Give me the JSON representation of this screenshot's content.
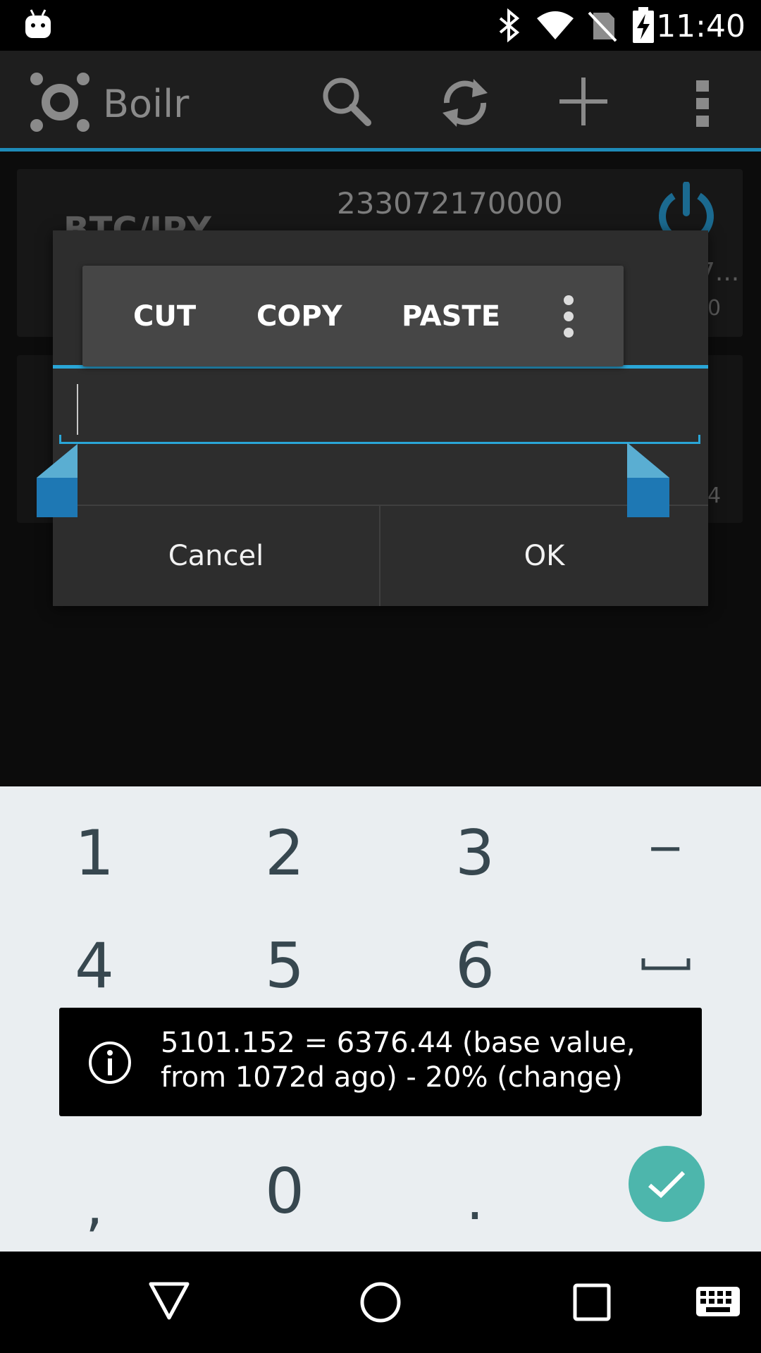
{
  "status_bar": {
    "time": "11:40"
  },
  "app": {
    "title": "Boilr"
  },
  "background": {
    "value": "233072170000",
    "pair": "BTC/JPY",
    "fragment_1": "7...",
    "fragment_2": "0",
    "fragment_3": "4"
  },
  "context_menu": {
    "cut": "CUT",
    "copy": "COPY",
    "paste": "PASTE"
  },
  "dialog": {
    "input_value": "",
    "cancel_label": "Cancel",
    "ok_label": "OK"
  },
  "keyboard": {
    "keys": [
      "1",
      "2",
      "3",
      "−",
      "4",
      "5",
      "6",
      ",",
      "0",
      "."
    ]
  },
  "toast": {
    "text": "5101.152 = 6376.44 (base value, from 1072d ago) - 20% (change)"
  },
  "colors": {
    "accent": "#2aa6d7",
    "handle": "#1e78b4",
    "enter_key": "#4db6ac",
    "keyboard_bg": "#eaeef1",
    "key_text": "#37474f"
  },
  "icons": {
    "app": "boilr-logo-icon",
    "status": [
      "android-notification-icon",
      "bluetooth-icon",
      "wifi-icon",
      "no-sim-icon",
      "battery-charging-icon"
    ],
    "actions": [
      "search-icon",
      "refresh-icon",
      "add-icon",
      "overflow-menu-icon"
    ],
    "nav": [
      "back-icon",
      "home-icon",
      "recents-icon",
      "keyboard-switch-icon"
    ]
  }
}
